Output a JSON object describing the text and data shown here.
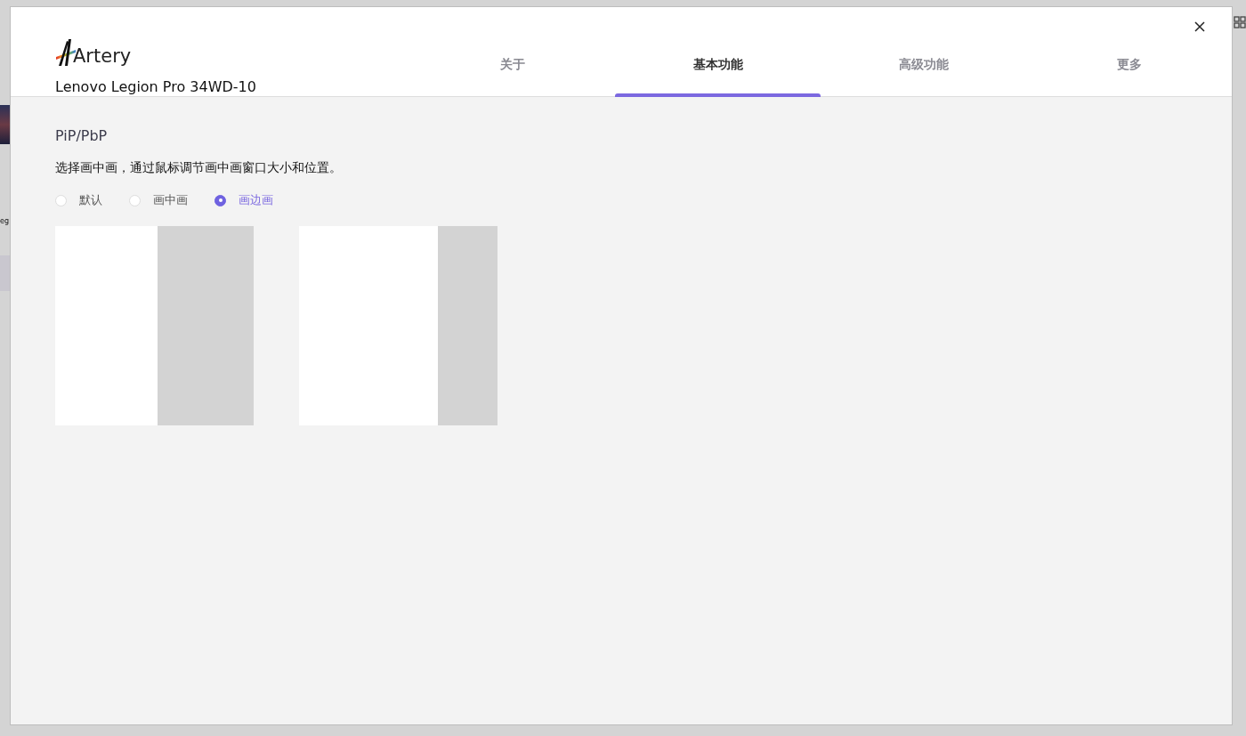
{
  "background": {
    "text_fragment": "eg"
  },
  "dialog": {
    "logo": "Artery",
    "device": "Lenovo Legion Pro 34WD-10",
    "tabs": [
      {
        "label": "关于",
        "selected": false
      },
      {
        "label": "基本功能",
        "selected": true
      },
      {
        "label": "高级功能",
        "selected": false
      },
      {
        "label": "更多",
        "selected": false
      }
    ],
    "section": {
      "title": "PiP/PbP",
      "description": "选择画中画，通过鼠标调节画中画窗口大小和位置。",
      "options": [
        {
          "label": "默认",
          "selected": false
        },
        {
          "label": "画中画",
          "selected": false
        },
        {
          "label": "画边画",
          "selected": true
        }
      ]
    }
  }
}
